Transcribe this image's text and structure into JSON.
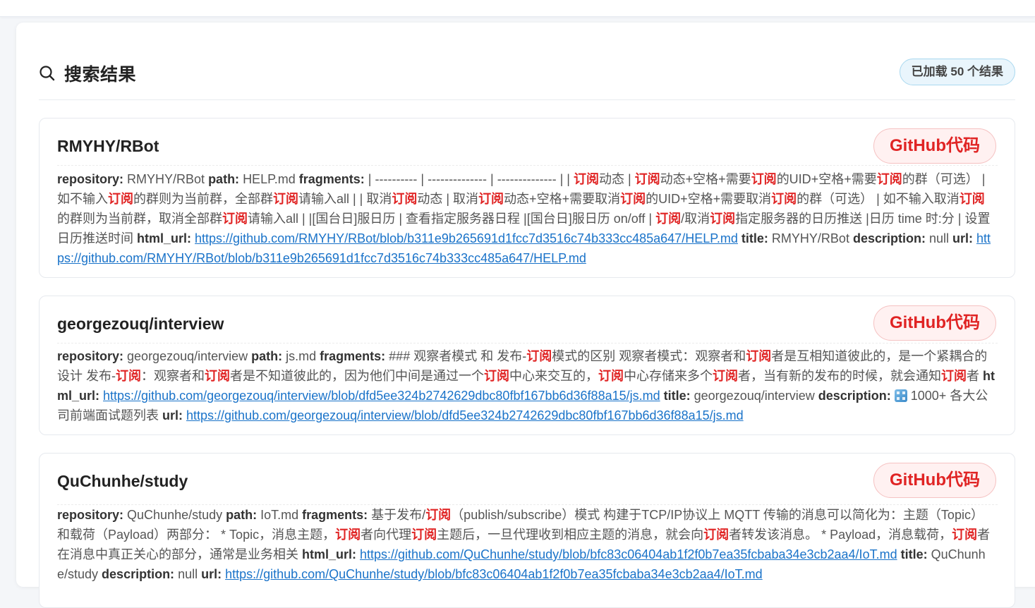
{
  "header": {
    "title": "搜索结果",
    "count_label": "已加载 50 个结果"
  },
  "results": [
    {
      "title": "RMYHY/RBot",
      "badge": "GitHub代码",
      "segments": [
        {
          "k": "b",
          "t": "repository: "
        },
        {
          "k": "t",
          "t": "RMYHY/RBot "
        },
        {
          "k": "b",
          "t": "path: "
        },
        {
          "k": "t",
          "t": "HELP.md "
        },
        {
          "k": "b",
          "t": "fragments: "
        },
        {
          "k": "t",
          "t": "| ---------- | -------------- | -------------- | | "
        },
        {
          "k": "h",
          "t": "订阅"
        },
        {
          "k": "t",
          "t": "动态 | "
        },
        {
          "k": "h",
          "t": "订阅"
        },
        {
          "k": "t",
          "t": "动态+空格+需要"
        },
        {
          "k": "h",
          "t": "订阅"
        },
        {
          "k": "t",
          "t": "的UID+空格+需要"
        },
        {
          "k": "h",
          "t": "订阅"
        },
        {
          "k": "t",
          "t": "的群（可选） | 如不输入"
        },
        {
          "k": "h",
          "t": "订阅"
        },
        {
          "k": "t",
          "t": "的群则为当前群，全部群"
        },
        {
          "k": "h",
          "t": "订阅"
        },
        {
          "k": "t",
          "t": "请输入all | | 取消"
        },
        {
          "k": "h",
          "t": "订阅"
        },
        {
          "k": "t",
          "t": "动态 | 取消"
        },
        {
          "k": "h",
          "t": "订阅"
        },
        {
          "k": "t",
          "t": "动态+空格+需要取消"
        },
        {
          "k": "h",
          "t": "订阅"
        },
        {
          "k": "t",
          "t": "的UID+空格+需要取消"
        },
        {
          "k": "h",
          "t": "订阅"
        },
        {
          "k": "t",
          "t": "的群（可选） | 如不输入取消"
        },
        {
          "k": "h",
          "t": "订阅"
        },
        {
          "k": "t",
          "t": "的群则为当前群，取消全部群"
        },
        {
          "k": "h",
          "t": "订阅"
        },
        {
          "k": "t",
          "t": "请输入all | |[国台日]服日历 | 查看指定服务器日程 |[国台日]服日历 on/off | "
        },
        {
          "k": "h",
          "t": "订阅"
        },
        {
          "k": "t",
          "t": "/取消"
        },
        {
          "k": "h",
          "t": "订阅"
        },
        {
          "k": "t",
          "t": "指定服务器的日历推送 |日历 time 时:分 | 设置日历推送时间 "
        },
        {
          "k": "b",
          "t": "html_url: "
        },
        {
          "k": "a",
          "t": "https://github.com/RMYHY/RBot/blob/b311e9b265691d1fcc7d3516c74b333cc485a647/HELP.md"
        },
        {
          "k": "t",
          "t": " "
        },
        {
          "k": "b",
          "t": "title: "
        },
        {
          "k": "t",
          "t": "RMYHY/RBot "
        },
        {
          "k": "b",
          "t": "description: "
        },
        {
          "k": "t",
          "t": "null "
        },
        {
          "k": "b",
          "t": "url: "
        },
        {
          "k": "a",
          "t": "https://github.com/RMYHY/RBot/blob/b311e9b265691d1fcc7d3516c74b333cc485a647/HELP.md"
        }
      ]
    },
    {
      "title": "georgezouq/interview",
      "badge": "GitHub代码",
      "segments": [
        {
          "k": "b",
          "t": "repository: "
        },
        {
          "k": "t",
          "t": "georgezouq/interview "
        },
        {
          "k": "b",
          "t": "path: "
        },
        {
          "k": "t",
          "t": "js.md "
        },
        {
          "k": "b",
          "t": "fragments: "
        },
        {
          "k": "t",
          "t": "### 观察者模式 和 发布-"
        },
        {
          "k": "h",
          "t": "订阅"
        },
        {
          "k": "t",
          "t": "模式的区别 观察者模式：观察者和"
        },
        {
          "k": "h",
          "t": "订阅"
        },
        {
          "k": "t",
          "t": "者是互相知道彼此的，是一个紧耦合的设计 发布-"
        },
        {
          "k": "h",
          "t": "订阅"
        },
        {
          "k": "t",
          "t": "：观察者和"
        },
        {
          "k": "h",
          "t": "订阅"
        },
        {
          "k": "t",
          "t": "者是不知道彼此的，因为他们中间是通过一个"
        },
        {
          "k": "h",
          "t": "订阅"
        },
        {
          "k": "t",
          "t": "中心来交互的，"
        },
        {
          "k": "h",
          "t": "订阅"
        },
        {
          "k": "t",
          "t": "中心存储来多个"
        },
        {
          "k": "h",
          "t": "订阅"
        },
        {
          "k": "t",
          "t": "者，当有新的发布的时候，就会通知"
        },
        {
          "k": "h",
          "t": "订阅"
        },
        {
          "k": "t",
          "t": "者 "
        },
        {
          "k": "b",
          "t": "html_url: "
        },
        {
          "k": "a",
          "t": "https://github.com/georgezouq/interview/blob/dfd5ee324b2742629dbc80fbf167bb6d36f88a15/js.md"
        },
        {
          "k": "t",
          "t": " "
        },
        {
          "k": "b",
          "t": "title: "
        },
        {
          "k": "t",
          "t": "georgezouq/interview "
        },
        {
          "k": "b",
          "t": "description: "
        },
        {
          "k": "e",
          "t": ""
        },
        {
          "k": "t",
          "t": " 1000+ 各大公司前端面试题列表 "
        },
        {
          "k": "b",
          "t": "url: "
        },
        {
          "k": "a",
          "t": "https://github.com/georgezouq/interview/blob/dfd5ee324b2742629dbc80fbf167bb6d36f88a15/js.md"
        }
      ]
    },
    {
      "title": "QuChunhe/study",
      "badge": "GitHub代码",
      "segments": [
        {
          "k": "b",
          "t": "repository: "
        },
        {
          "k": "t",
          "t": "QuChunhe/study "
        },
        {
          "k": "b",
          "t": "path: "
        },
        {
          "k": "t",
          "t": "IoT.md "
        },
        {
          "k": "b",
          "t": "fragments: "
        },
        {
          "k": "t",
          "t": "基于发布/"
        },
        {
          "k": "h",
          "t": "订阅"
        },
        {
          "k": "t",
          "t": "（publish/subscribe）模式 构建于TCP/IP协议上 MQTT 传输的消息可以简化为：主题（Topic）和载荷（Payload）两部分：  * Topic，消息主题，"
        },
        {
          "k": "h",
          "t": "订阅"
        },
        {
          "k": "t",
          "t": "者向代理"
        },
        {
          "k": "h",
          "t": "订阅"
        },
        {
          "k": "t",
          "t": "主题后，一旦代理收到相应主题的消息，就会向"
        },
        {
          "k": "h",
          "t": "订阅"
        },
        {
          "k": "t",
          "t": "者转发该消息。 * Payload，消息载荷，"
        },
        {
          "k": "h",
          "t": "订阅"
        },
        {
          "k": "t",
          "t": "者在消息中真正关心的部分，通常是业务相关 "
        },
        {
          "k": "b",
          "t": "html_url: "
        },
        {
          "k": "a",
          "t": "https://github.com/QuChunhe/study/blob/bfc83c06404ab1f2f0b7ea35fcbaba34e3cb2aa4/IoT.md"
        },
        {
          "k": "t",
          "t": " "
        },
        {
          "k": "b",
          "t": "title: "
        },
        {
          "k": "t",
          "t": "QuChunhe/study "
        },
        {
          "k": "b",
          "t": "description: "
        },
        {
          "k": "t",
          "t": "null "
        },
        {
          "k": "b",
          "t": "url: "
        },
        {
          "k": "a",
          "t": "https://github.com/QuChunhe/study/blob/bfc83c06404ab1f2f0b7ea35fcbaba34e3cb2aa4/IoT.md"
        }
      ]
    }
  ]
}
